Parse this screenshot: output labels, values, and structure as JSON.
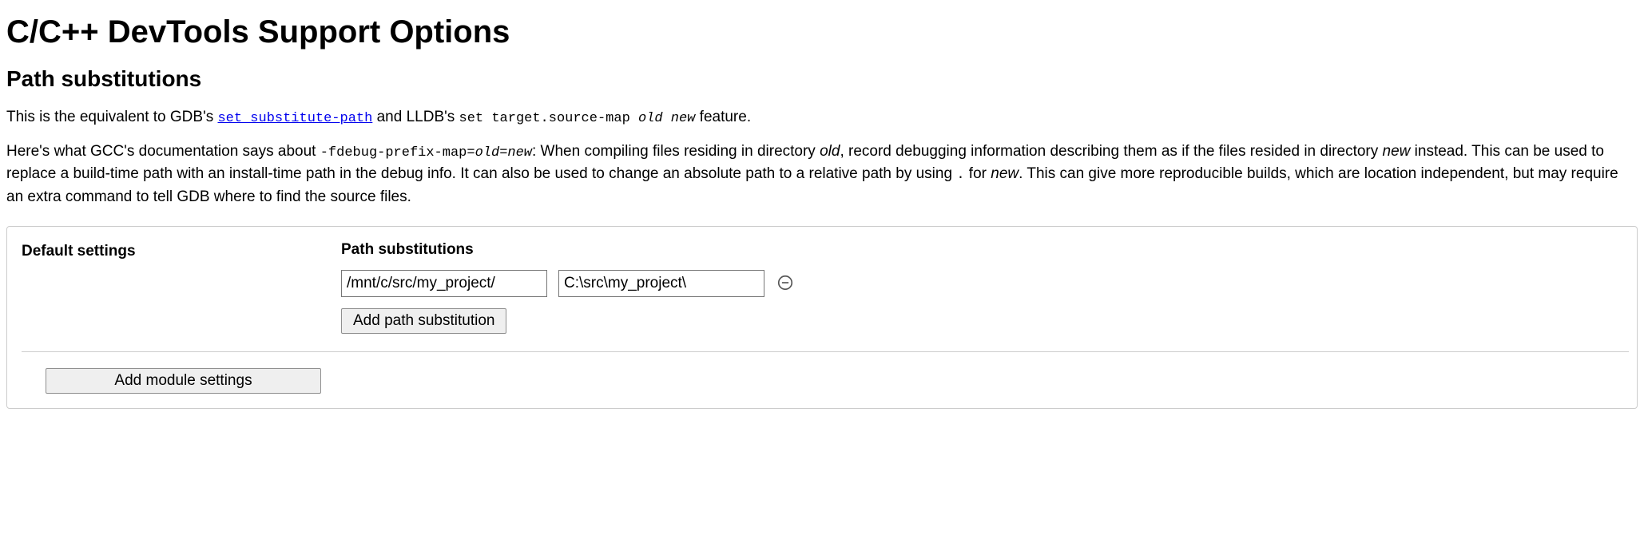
{
  "title": "C/C++ DevTools Support Options",
  "section_heading": "Path substitutions",
  "para1": {
    "t0": "This is the equivalent to GDB's ",
    "link_set_substitute": "set substitute-path",
    "t1": " and LLDB's ",
    "code_set_target": "set target.source-map ",
    "italic_old": "old",
    "space": " ",
    "italic_new": "new",
    "t2": " feature."
  },
  "para2": {
    "t0": "Here's what GCC's documentation says about ",
    "code_flag": "-fdebug-prefix-map=",
    "italic_old": "old",
    "eq": "=",
    "italic_new": "new",
    "t1": ": When compiling files residing in directory ",
    "italic_old2": "old",
    "t2": ", record debugging information describing them as if the files resided in directory ",
    "italic_new2": "new",
    "t3": " instead. This can be used to replace a build-time path with an install-time path in the debug info. It can also be used to change an absolute path to a relative path by using ",
    "code_dot": ".",
    "t4": " for ",
    "italic_new3": "new",
    "t5": ". This can give more reproducible builds, which are location independent, but may require an extra command to tell GDB where to find the source files."
  },
  "settings": {
    "default_label": "Default settings",
    "path_sub_label": "Path substitutions",
    "row": {
      "from": "/mnt/c/src/my_project/",
      "to": "C:\\src\\my_project\\"
    },
    "add_path_btn": "Add path substitution",
    "add_module_btn": "Add module settings"
  }
}
